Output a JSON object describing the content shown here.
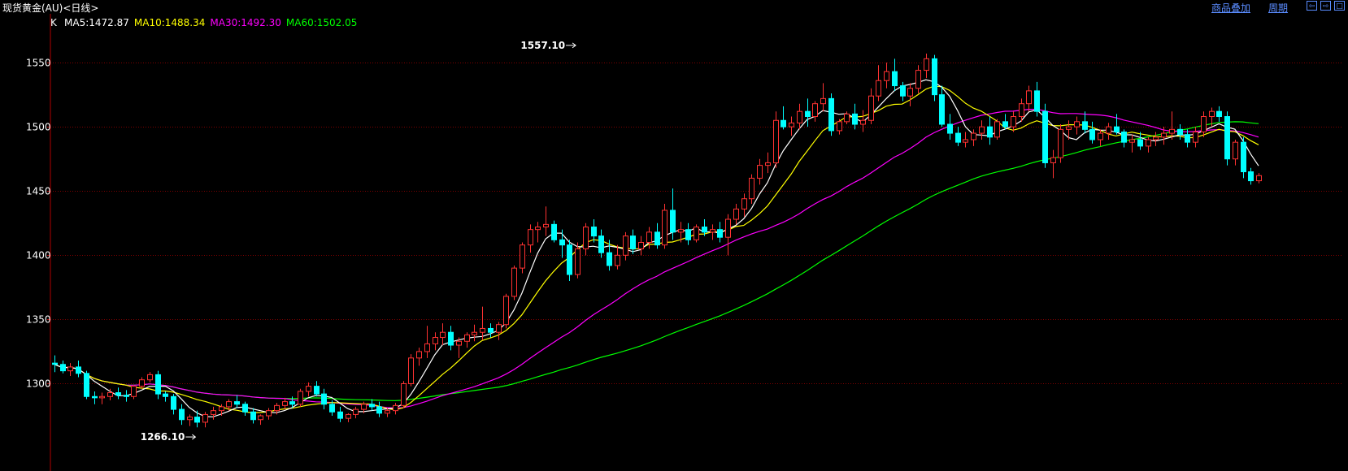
{
  "window": {
    "title": "现货黄金(AU)<日线>",
    "links": {
      "overlay": "商品叠加",
      "period": "周期"
    },
    "buttons": {
      "left": "⇦",
      "right": "⇨",
      "max": "□"
    }
  },
  "chart_data": {
    "type": "candlestick",
    "indicator_prefix": "K",
    "legend": [
      {
        "text": "MA5:1472.87",
        "color": "#ffffff"
      },
      {
        "text": "MA10:1488.34",
        "color": "#ffff00"
      },
      {
        "text": "MA30:1492.30",
        "color": "#ff00ff"
      },
      {
        "text": "MA60:1502.05",
        "color": "#00ff00"
      }
    ],
    "colors": {
      "up": "#ff3232",
      "down": "#00ffff",
      "grid": "#800000",
      "axis": "#b00000"
    },
    "ylim": [
      1232,
      1588
    ],
    "yticks": [
      1300,
      1350,
      1400,
      1450,
      1500,
      1550
    ],
    "annotations": [
      {
        "text": "1557.10",
        "index": 66,
        "value": 1557.1,
        "side": "left"
      },
      {
        "text": "1266.10",
        "index": 18,
        "value": 1266.1,
        "side": "left"
      }
    ],
    "candles": [
      [
        1316,
        1322,
        1309,
        1315
      ],
      [
        1315,
        1318,
        1308,
        1310
      ],
      [
        1310,
        1316,
        1306,
        1313
      ],
      [
        1313,
        1318,
        1305,
        1308
      ],
      [
        1308,
        1310,
        1288,
        1290
      ],
      [
        1290,
        1294,
        1284,
        1289
      ],
      [
        1289,
        1293,
        1284,
        1290
      ],
      [
        1290,
        1296,
        1287,
        1293
      ],
      [
        1293,
        1297,
        1288,
        1291
      ],
      [
        1291,
        1295,
        1286,
        1290
      ],
      [
        1290,
        1299,
        1288,
        1298
      ],
      [
        1298,
        1305,
        1296,
        1303
      ],
      [
        1303,
        1309,
        1301,
        1307
      ],
      [
        1307,
        1310,
        1288,
        1292
      ],
      [
        1292,
        1294,
        1286,
        1290
      ],
      [
        1290,
        1292,
        1276,
        1280
      ],
      [
        1280,
        1284,
        1268,
        1272
      ],
      [
        1272,
        1276,
        1267,
        1274
      ],
      [
        1274,
        1279,
        1266,
        1270
      ],
      [
        1270,
        1278,
        1266,
        1276
      ],
      [
        1276,
        1282,
        1272,
        1279
      ],
      [
        1279,
        1284,
        1275,
        1282
      ],
      [
        1282,
        1288,
        1279,
        1286
      ],
      [
        1286,
        1291,
        1281,
        1284
      ],
      [
        1284,
        1286,
        1275,
        1278
      ],
      [
        1278,
        1281,
        1269,
        1272
      ],
      [
        1272,
        1276,
        1268,
        1275
      ],
      [
        1275,
        1281,
        1272,
        1279
      ],
      [
        1279,
        1285,
        1276,
        1283
      ],
      [
        1283,
        1289,
        1280,
        1286
      ],
      [
        1286,
        1290,
        1281,
        1284
      ],
      [
        1284,
        1296,
        1282,
        1294
      ],
      [
        1294,
        1301,
        1290,
        1298
      ],
      [
        1298,
        1302,
        1290,
        1292
      ],
      [
        1292,
        1296,
        1280,
        1284
      ],
      [
        1284,
        1287,
        1275,
        1278
      ],
      [
        1278,
        1282,
        1270,
        1273
      ],
      [
        1273,
        1277,
        1270,
        1276
      ],
      [
        1276,
        1282,
        1273,
        1280
      ],
      [
        1280,
        1286,
        1277,
        1284
      ],
      [
        1284,
        1288,
        1279,
        1282
      ],
      [
        1282,
        1286,
        1274,
        1277
      ],
      [
        1277,
        1281,
        1274,
        1279
      ],
      [
        1279,
        1285,
        1276,
        1283
      ],
      [
        1283,
        1302,
        1281,
        1300
      ],
      [
        1300,
        1323,
        1298,
        1320
      ],
      [
        1320,
        1328,
        1314,
        1325
      ],
      [
        1325,
        1345,
        1320,
        1331
      ],
      [
        1331,
        1340,
        1326,
        1336
      ],
      [
        1336,
        1347,
        1330,
        1340
      ],
      [
        1340,
        1345,
        1326,
        1330
      ],
      [
        1330,
        1336,
        1320,
        1333
      ],
      [
        1333,
        1340,
        1328,
        1338
      ],
      [
        1338,
        1346,
        1333,
        1340
      ],
      [
        1340,
        1360,
        1334,
        1343
      ],
      [
        1343,
        1347,
        1336,
        1340
      ],
      [
        1340,
        1348,
        1334,
        1346
      ],
      [
        1346,
        1370,
        1343,
        1368
      ],
      [
        1368,
        1392,
        1365,
        1390
      ],
      [
        1390,
        1410,
        1386,
        1408
      ],
      [
        1408,
        1424,
        1402,
        1420
      ],
      [
        1420,
        1426,
        1410,
        1422
      ],
      [
        1422,
        1438,
        1415,
        1424
      ],
      [
        1424,
        1427,
        1410,
        1412
      ],
      [
        1412,
        1420,
        1398,
        1408
      ],
      [
        1408,
        1412,
        1380,
        1385
      ],
      [
        1385,
        1410,
        1382,
        1405
      ],
      [
        1405,
        1425,
        1400,
        1422
      ],
      [
        1422,
        1428,
        1410,
        1415
      ],
      [
        1415,
        1420,
        1398,
        1402
      ],
      [
        1402,
        1412,
        1388,
        1392
      ],
      [
        1392,
        1408,
        1389,
        1400
      ],
      [
        1400,
        1418,
        1396,
        1415
      ],
      [
        1415,
        1420,
        1401,
        1405
      ],
      [
        1405,
        1415,
        1400,
        1410
      ],
      [
        1410,
        1422,
        1405,
        1418
      ],
      [
        1418,
        1425,
        1405,
        1408
      ],
      [
        1408,
        1440,
        1405,
        1435
      ],
      [
        1435,
        1452,
        1412,
        1418
      ],
      [
        1418,
        1426,
        1410,
        1420
      ],
      [
        1420,
        1425,
        1408,
        1412
      ],
      [
        1412,
        1424,
        1410,
        1422
      ],
      [
        1422,
        1428,
        1415,
        1418
      ],
      [
        1418,
        1424,
        1412,
        1420
      ],
      [
        1420,
        1426,
        1410,
        1414
      ],
      [
        1414,
        1432,
        1400,
        1428
      ],
      [
        1428,
        1440,
        1424,
        1436
      ],
      [
        1436,
        1448,
        1430,
        1444
      ],
      [
        1444,
        1463,
        1440,
        1460
      ],
      [
        1460,
        1475,
        1455,
        1470
      ],
      [
        1470,
        1480,
        1464,
        1472
      ],
      [
        1472,
        1512,
        1468,
        1505
      ],
      [
        1505,
        1516,
        1498,
        1500
      ],
      [
        1500,
        1508,
        1493,
        1503
      ],
      [
        1503,
        1518,
        1498,
        1512
      ],
      [
        1512,
        1522,
        1500,
        1508
      ],
      [
        1508,
        1520,
        1504,
        1518
      ],
      [
        1518,
        1534,
        1512,
        1522
      ],
      [
        1522,
        1526,
        1493,
        1497
      ],
      [
        1497,
        1506,
        1494,
        1504
      ],
      [
        1504,
        1512,
        1502,
        1510
      ],
      [
        1510,
        1518,
        1498,
        1502
      ],
      [
        1502,
        1513,
        1496,
        1505
      ],
      [
        1505,
        1530,
        1502,
        1524
      ],
      [
        1524,
        1548,
        1520,
        1536
      ],
      [
        1536,
        1550,
        1530,
        1543
      ],
      [
        1543,
        1553,
        1528,
        1532
      ],
      [
        1532,
        1535,
        1520,
        1524
      ],
      [
        1524,
        1534,
        1516,
        1530
      ],
      [
        1530,
        1548,
        1526,
        1544
      ],
      [
        1544,
        1557,
        1538,
        1553
      ],
      [
        1553,
        1556,
        1520,
        1525
      ],
      [
        1525,
        1532,
        1500,
        1502
      ],
      [
        1502,
        1510,
        1490,
        1495
      ],
      [
        1495,
        1500,
        1485,
        1488
      ],
      [
        1488,
        1496,
        1484,
        1490
      ],
      [
        1490,
        1498,
        1485,
        1495
      ],
      [
        1495,
        1505,
        1490,
        1500
      ],
      [
        1500,
        1508,
        1486,
        1492
      ],
      [
        1492,
        1506,
        1490,
        1504
      ],
      [
        1504,
        1510,
        1498,
        1500
      ],
      [
        1500,
        1512,
        1496,
        1508
      ],
      [
        1508,
        1522,
        1504,
        1518
      ],
      [
        1518,
        1532,
        1512,
        1528
      ],
      [
        1528,
        1535,
        1508,
        1512
      ],
      [
        1512,
        1518,
        1468,
        1472
      ],
      [
        1472,
        1482,
        1460,
        1476
      ],
      [
        1476,
        1502,
        1472,
        1498
      ],
      [
        1498,
        1505,
        1490,
        1500
      ],
      [
        1500,
        1508,
        1494,
        1504
      ],
      [
        1504,
        1512,
        1495,
        1498
      ],
      [
        1498,
        1504,
        1487,
        1490
      ],
      [
        1490,
        1498,
        1485,
        1495
      ],
      [
        1495,
        1503,
        1490,
        1500
      ],
      [
        1500,
        1510,
        1494,
        1496
      ],
      [
        1496,
        1498,
        1484,
        1488
      ],
      [
        1488,
        1494,
        1480,
        1490
      ],
      [
        1490,
        1496,
        1482,
        1485
      ],
      [
        1485,
        1492,
        1480,
        1490
      ],
      [
        1490,
        1496,
        1485,
        1492
      ],
      [
        1492,
        1500,
        1486,
        1495
      ],
      [
        1495,
        1512,
        1490,
        1498
      ],
      [
        1498,
        1502,
        1490,
        1494
      ],
      [
        1494,
        1498,
        1484,
        1488
      ],
      [
        1488,
        1500,
        1484,
        1496
      ],
      [
        1496,
        1512,
        1492,
        1508
      ],
      [
        1508,
        1515,
        1500,
        1512
      ],
      [
        1512,
        1516,
        1504,
        1508
      ],
      [
        1508,
        1512,
        1470,
        1475
      ],
      [
        1475,
        1490,
        1470,
        1488
      ],
      [
        1488,
        1492,
        1460,
        1465
      ],
      [
        1465,
        1468,
        1455,
        1458
      ],
      [
        1458,
        1464,
        1456,
        1462
      ]
    ]
  }
}
